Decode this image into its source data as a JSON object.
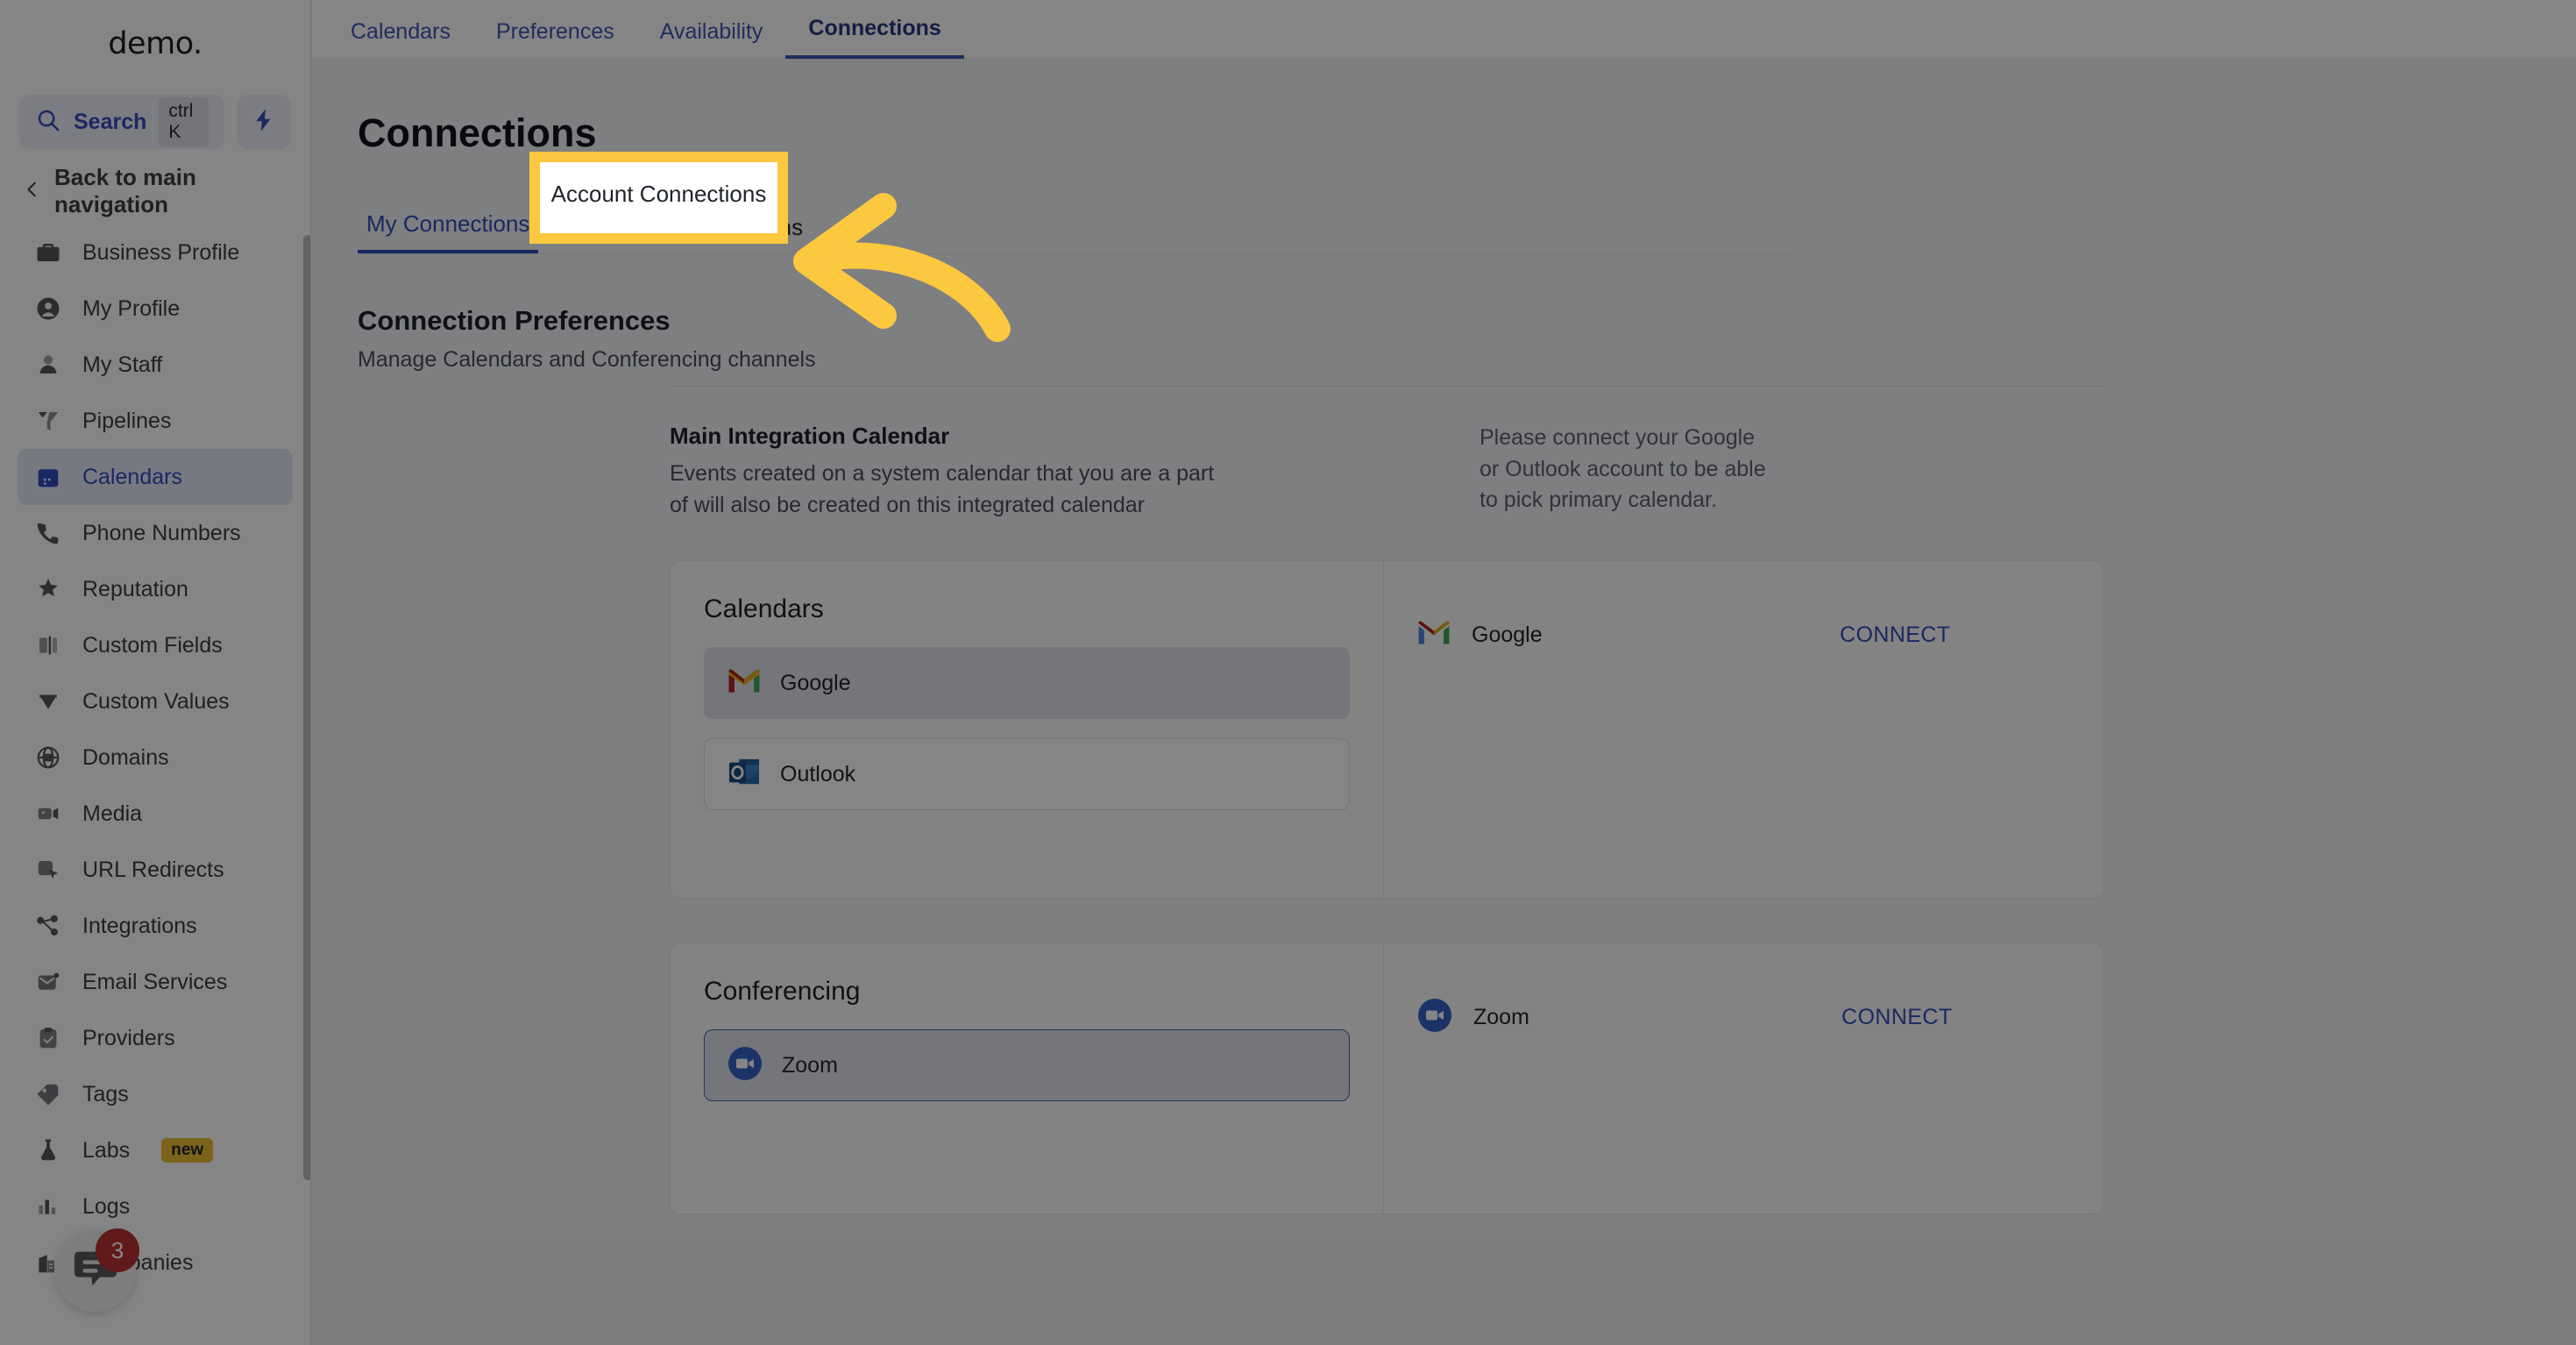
{
  "brand": {
    "name": "demo",
    "suffix": "."
  },
  "sidebar": {
    "search": {
      "label": "Search",
      "shortcut": "ctrl K",
      "placeholder": "Search"
    },
    "bolt_icon": "lightning-bolt-icon",
    "back": {
      "label": "Back to main navigation",
      "icon": "chevron-left-icon"
    },
    "items": [
      {
        "label": "Business Profile",
        "icon": "briefcase-icon",
        "active": false
      },
      {
        "label": "My Profile",
        "icon": "user-circle-icon",
        "active": false
      },
      {
        "label": "My Staff",
        "icon": "user-icon",
        "active": false
      },
      {
        "label": "Pipelines",
        "icon": "funnel-icon",
        "active": false
      },
      {
        "label": "Calendars",
        "icon": "calendar-icon",
        "active": true
      },
      {
        "label": "Phone Numbers",
        "icon": "phone-icon",
        "active": false
      },
      {
        "label": "Reputation",
        "icon": "star-icon",
        "active": false
      },
      {
        "label": "Custom Fields",
        "icon": "field-icon",
        "active": false
      },
      {
        "label": "Custom Values",
        "icon": "gem-icon",
        "active": false
      },
      {
        "label": "Domains",
        "icon": "globe-icon",
        "active": false
      },
      {
        "label": "Media",
        "icon": "video-camera-icon",
        "active": false
      },
      {
        "label": "URL Redirects",
        "icon": "cursor-click-icon",
        "active": false
      },
      {
        "label": "Integrations",
        "icon": "share-nodes-icon",
        "active": false
      },
      {
        "label": "Email Services",
        "icon": "envelope-icon",
        "active": false
      },
      {
        "label": "Providers",
        "icon": "clipboard-check-icon",
        "active": false
      },
      {
        "label": "Tags",
        "icon": "tag-icon",
        "active": false
      },
      {
        "label": "Labs",
        "icon": "flask-icon",
        "active": false,
        "badge": "new"
      },
      {
        "label": "Logs",
        "icon": "bar-chart-icon",
        "active": false
      },
      {
        "label": "Companies",
        "icon": "building-icon",
        "active": false
      }
    ],
    "chat_widget": {
      "icon": "chat-bubble-icon",
      "unread_count": "3"
    }
  },
  "topbar": {
    "tabs": [
      {
        "label": "Calendars",
        "active": false
      },
      {
        "label": "Preferences",
        "active": false
      },
      {
        "label": "Availability",
        "active": false
      },
      {
        "label": "Connections",
        "active": true
      }
    ]
  },
  "page": {
    "title": "Connections",
    "subtabs": [
      {
        "label": "My Connections",
        "active": true
      },
      {
        "label": "Account Connections",
        "active": false,
        "highlighted": true
      }
    ],
    "section": {
      "title": "Connection Preferences",
      "subtitle": "Manage Calendars and Conferencing channels"
    },
    "main_integration": {
      "title": "Main Integration Calendar",
      "description": "Events created on a system calendar that you are a part of will also be created on this integrated calendar",
      "note": "Please connect your Google or Outlook account to be able to pick primary calendar."
    },
    "calendars_card": {
      "heading": "Calendars",
      "options": [
        {
          "label": "Google",
          "icon": "gmail-icon",
          "state": "selected"
        },
        {
          "label": "Outlook",
          "icon": "outlook-icon",
          "state": "default"
        }
      ],
      "connections": [
        {
          "name": "Google",
          "icon": "gmail-icon",
          "action": "CONNECT"
        }
      ]
    },
    "conferencing_card": {
      "heading": "Conferencing",
      "options": [
        {
          "label": "Zoom",
          "icon": "zoom-icon",
          "state": "selected-outline"
        }
      ],
      "connections": [
        {
          "name": "Zoom",
          "icon": "zoom-icon",
          "action": "CONNECT"
        }
      ]
    }
  },
  "highlight": {
    "label": "Account Connections",
    "box_color": "#fbc83f",
    "arrow_color": "#fbc83f",
    "arrow_icon": "curved-left-arrow-icon"
  },
  "colors": {
    "accent": "#2b4dd0",
    "highlight": "#fbc83f",
    "badge_new": "#f5c11a",
    "unread": "#cf2a2a"
  }
}
